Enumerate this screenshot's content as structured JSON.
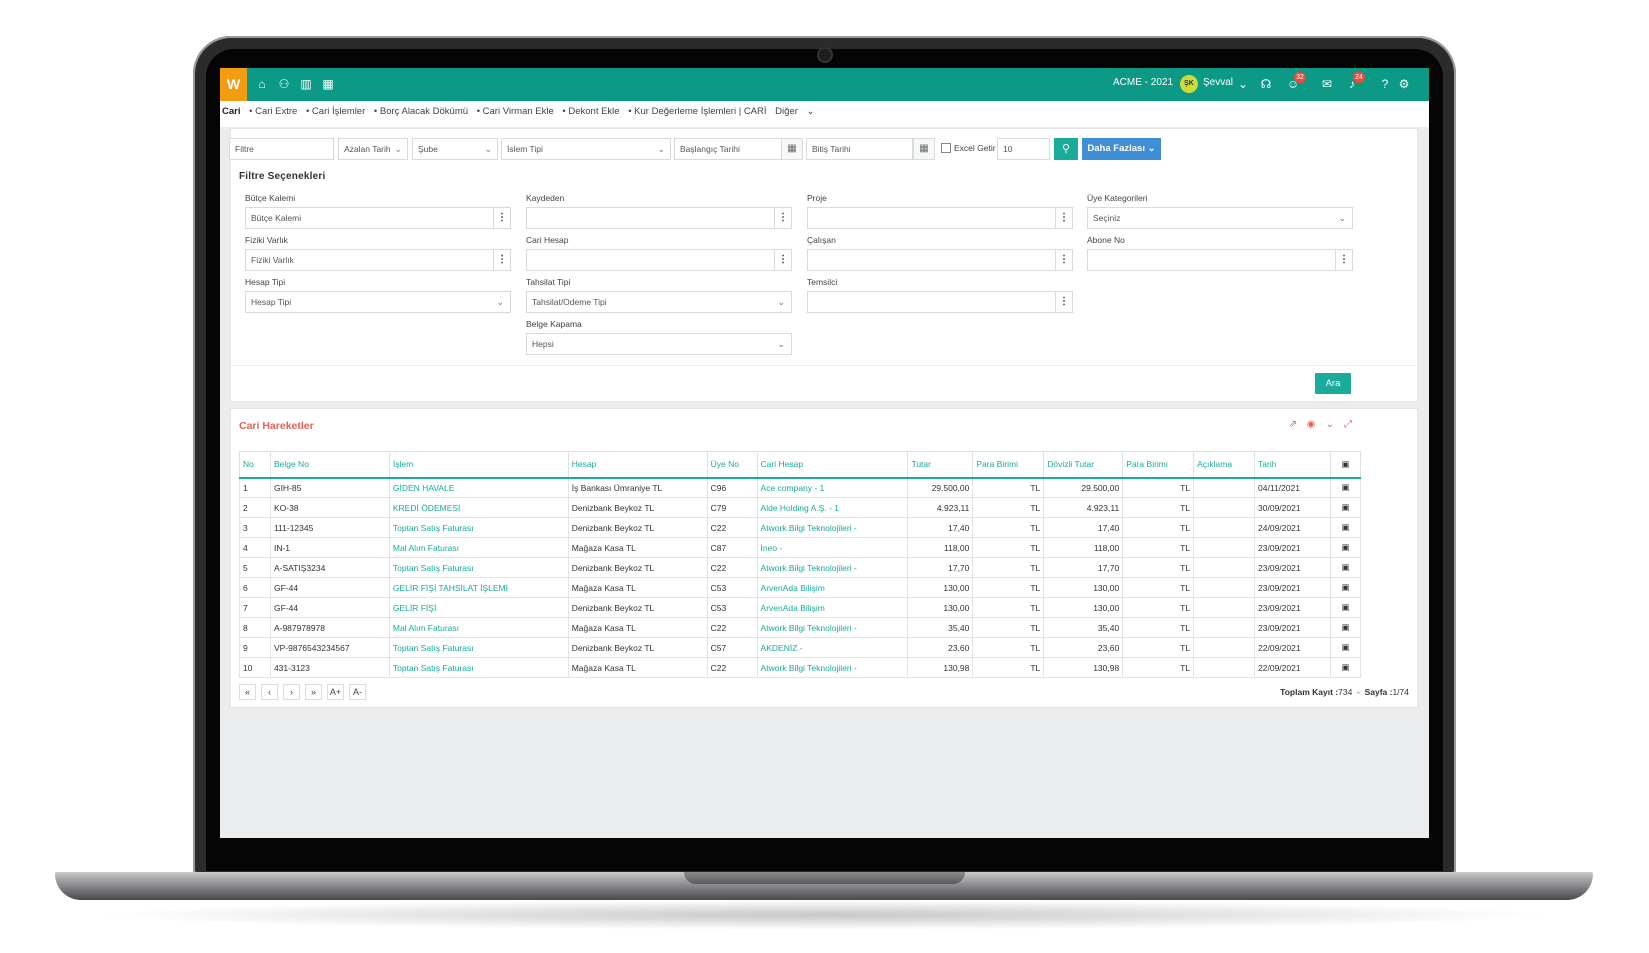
{
  "app": {
    "logo": "W",
    "company": "ACME - 2021",
    "avatar_initials": "ŞK",
    "username": "Şevval",
    "badges": {
      "support": "32",
      "notifications": "24"
    },
    "colors": {
      "primary": "#0c9a87",
      "accent": "#1aab9b",
      "logo": "#f39c12",
      "title_red": "#e0645a",
      "button_blue": "#3e8fd6",
      "badge": "#e74c3c"
    }
  },
  "breadcrumb": {
    "items": [
      "Cari",
      "• Cari Extre",
      "• Cari İşlemler",
      "• Borç Alacak Dökümü",
      "• Cari Virman Ekle",
      "• Dekont Ekle",
      "• Kur Değerleme İşlemleri | CARİ",
      "Diğer"
    ]
  },
  "filters": {
    "filter_placeholder": "Filtre",
    "sort": "Azalan Tarih",
    "branch": "Şube",
    "process_type": "İslem Tipi",
    "start_date": "Başlangıç Tarihi",
    "end_date": "Bitiş Tarihi",
    "excel_label": "Excel Getir",
    "page_size": "10",
    "more_label": "Daha Fazlası",
    "options_title": "Filtre Seçenekleri",
    "search_label": "Ara",
    "fields": {
      "budget_label": "Bütçe Kalemi",
      "budget_value": "Bütçe Kalemi",
      "recorder_label": "Kaydeden",
      "project_label": "Proje",
      "member_cat_label": "Üye Kategorileri",
      "member_cat_value": "Seçiniz",
      "asset_label": "Fiziki Varlık",
      "asset_value": "Fiziki Varlık",
      "account_label": "Cari Hesap",
      "employee_label": "Çalışan",
      "subscriber_label": "Abone No",
      "acc_type_label": "Hesap Tipi",
      "acc_type_value": "Hesap Tipi",
      "collection_label": "Tahsilat Tipi",
      "collection_value": "Tahsilat/Odeme Tipi",
      "rep_label": "Temsilci",
      "doc_close_label": "Belge Kapama",
      "doc_close_value": "Hepsi"
    }
  },
  "results": {
    "title": "Cari Hareketler",
    "columns": [
      "No",
      "Belge No",
      "İşlem",
      "Hesap",
      "Üye No",
      "Cari Hesap",
      "Tutar",
      "Para Birimi",
      "Dövizli Tutar",
      "Para Birimi",
      "Açıklama",
      "Tarih"
    ],
    "rows": [
      [
        "1",
        "GIH-85",
        "GİDEN HAVALE",
        "İş Bankası Ümraniye TL",
        "C96",
        "Ace company - 1",
        "29.500,00",
        "TL",
        "29.500,00",
        "TL",
        "",
        "04/11/2021"
      ],
      [
        "2",
        "KO-38",
        "KREDİ ÖDEMESİ",
        "Denizbank Beykoz TL",
        "C79",
        "Alde Holding A.Ş. - 1",
        "4.923,11",
        "TL",
        "4.923,11",
        "TL",
        "",
        "30/09/2021"
      ],
      [
        "3",
        "111-12345",
        "Toptan Satış Faturası",
        "Denizbank Beykoz TL",
        "C22",
        "Atwork Bilgi Teknolojileri -",
        "17,40",
        "TL",
        "17,40",
        "TL",
        "",
        "24/09/2021"
      ],
      [
        "4",
        "IN-1",
        "Mal Alım Faturası",
        "Mağaza Kasa TL",
        "C87",
        "İneo -",
        "118,00",
        "TL",
        "118,00",
        "TL",
        "",
        "23/09/2021"
      ],
      [
        "5",
        "A-SATIŞ3234",
        "Toptan Satış Faturası",
        "Denizbank Beykoz TL",
        "C22",
        "Atwork Bilgi Teknolojileri -",
        "17,70",
        "TL",
        "17,70",
        "TL",
        "",
        "23/09/2021"
      ],
      [
        "6",
        "GF-44",
        "GELİR FİŞİ TAHSİLAT İŞLEMİ",
        "Mağaza Kasa TL",
        "C53",
        "ArvenAda Bilişim",
        "130,00",
        "TL",
        "130,00",
        "TL",
        "",
        "23/09/2021"
      ],
      [
        "7",
        "GF-44",
        "GELİR FİŞİ",
        "Denizbank Beykoz TL",
        "C53",
        "ArvenAda Bilişim",
        "130,00",
        "TL",
        "130,00",
        "TL",
        "",
        "23/09/2021"
      ],
      [
        "8",
        "A-987978978",
        "Mal Alım Faturası",
        "Mağaza Kasa TL",
        "C22",
        "Atwork Bilgi Teknolojileri -",
        "35,40",
        "TL",
        "35,40",
        "TL",
        "",
        "23/09/2021"
      ],
      [
        "9",
        "VP-9876543234567",
        "Toptan Satış Faturası",
        "Denizbank Beykoz TL",
        "C57",
        "AKDENİZ -",
        "23,60",
        "TL",
        "23,60",
        "TL",
        "",
        "22/09/2021"
      ],
      [
        "10",
        "431-3123",
        "Toptan Satış Faturası",
        "Mağaza Kasa TL",
        "C22",
        "Atwork Bilgi Teknolojileri -",
        "130,98",
        "TL",
        "130,98",
        "TL",
        "",
        "22/09/2021"
      ]
    ],
    "pager": [
      "«",
      "‹",
      "›",
      "»",
      "A+",
      "A-"
    ],
    "total_label": "Toplam Kayıt :",
    "total_value": "734",
    "page_label": "Sayfa :",
    "page_value": "1/74"
  }
}
